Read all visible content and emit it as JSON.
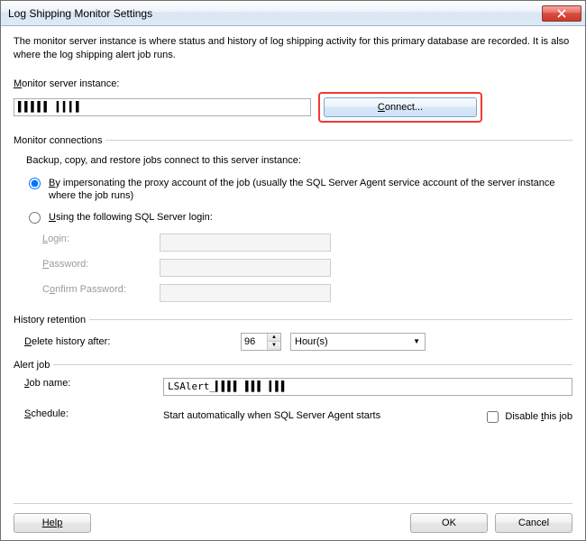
{
  "window": {
    "title": "Log Shipping Monitor Settings"
  },
  "intro": "The monitor server instance is where status and history of log shipping activity for this primary database are recorded. It is also where the log shipping alert job runs.",
  "monitor": {
    "label_pre": "",
    "label_u": "M",
    "label_post": "onitor server instance:",
    "value": "▌▌▌▌▌ ▍▍▍▌",
    "connect_u": "C",
    "connect_post": "onnect..."
  },
  "connections": {
    "legend": "Monitor connections",
    "subtext": "Backup, copy, and restore jobs connect to this server instance:",
    "radio_impersonate_u": "B",
    "radio_impersonate_post": "y impersonating the proxy account of the job (usually the SQL Server Agent service account of the server instance where the job runs)",
    "radio_sql_u": "U",
    "radio_sql_post": "sing the following SQL Server login:",
    "login_u": "L",
    "login_post": "ogin:",
    "password_u": "P",
    "password_post": "assword:",
    "confirm_pre": "C",
    "confirm_u": "o",
    "confirm_post": "nfirm Password:"
  },
  "history": {
    "legend": "History retention",
    "label_u": "D",
    "label_post": "elete history after:",
    "value": "96",
    "unit": "Hour(s)"
  },
  "alert": {
    "legend": "Alert job",
    "jobname_u": "J",
    "jobname_post": "ob name:",
    "jobname_value": "LSAlert_▍▌▌▌ ▌▌▌ ▍▌▌",
    "schedule_u": "S",
    "schedule_post": "chedule:",
    "schedule_text": "Start automatically when SQL Server Agent starts",
    "disable_pre": "Disable ",
    "disable_u": "t",
    "disable_post": "his job"
  },
  "buttons": {
    "help": "Help",
    "ok": "OK",
    "cancel": "Cancel"
  }
}
